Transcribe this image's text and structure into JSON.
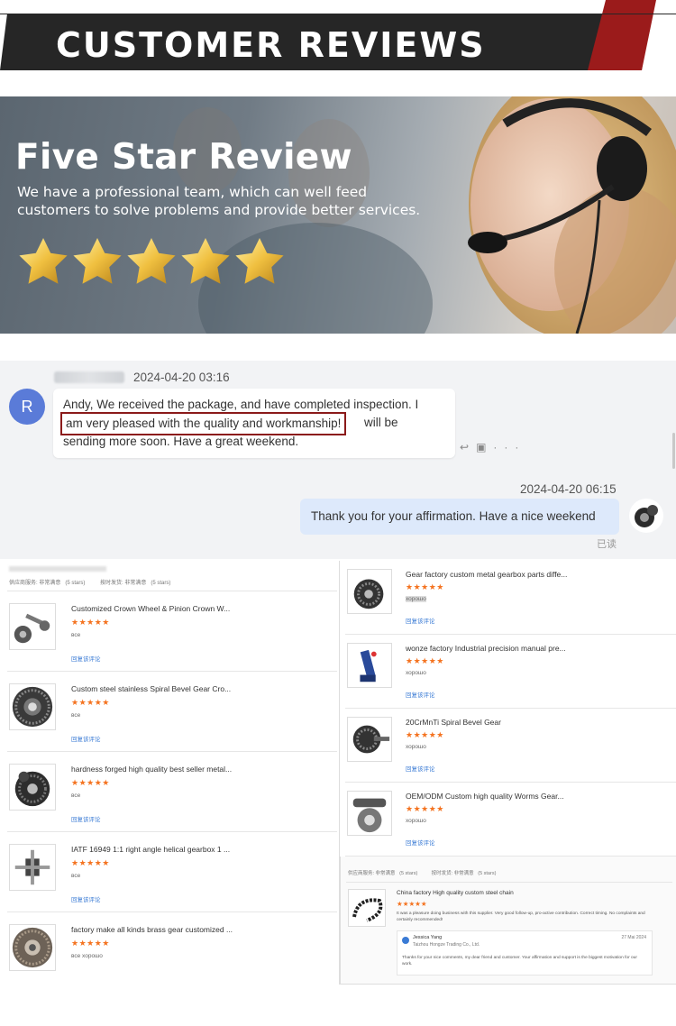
{
  "banner": {
    "title": "CUSTOMER REVIEWS",
    "colors": {
      "bar": "#262626",
      "accent": "#9b1b1b"
    }
  },
  "hero": {
    "title": "Five Star Review",
    "subtitle": "We have a professional team, which can well feed customers to solve problems and provide better services.",
    "stars": 5
  },
  "chat": {
    "incoming": {
      "avatar_letter": "R",
      "timestamp": "2024-04-20 03:16",
      "text_before": "Andy, We received the package, and have completed inspection. I",
      "highlight": "am very pleased with the quality and workmanship!",
      "text_after": "will be",
      "text_last": "sending more soon. Have a great weekend."
    },
    "outgoing": {
      "timestamp": "2024-04-20 06:15",
      "text": "Thank you for your affirmation. Have a nice weekend",
      "status": "已读"
    }
  },
  "reviews_left": {
    "header": "供应商服务: 非常满意   (5 stars)          按时发货: 非常满意   (5 stars)",
    "link_label": "回复该评论",
    "items": [
      {
        "title": "Customized Crown Wheel & Pinion Crown W...",
        "text": "все"
      },
      {
        "title": "Custom steel stainless Spiral Bevel Gear Cro...",
        "text": "все"
      },
      {
        "title": "hardness forged high quality best seller metal...",
        "text": "все"
      },
      {
        "title": "IATF 16949 1:1 right angle helical gearbox 1 ...",
        "text": "все"
      },
      {
        "title": "factory make all kinds brass gear customized ...",
        "text": "все хорошо"
      }
    ]
  },
  "reviews_right": {
    "link_label": "回复该评论",
    "items": [
      {
        "title": "Gear factory custom metal gearbox parts diffe...",
        "text": "хорошо"
      },
      {
        "title": "wonze factory Industrial precision manual pre...",
        "text": "хорошо"
      },
      {
        "title": "20CrMnTi Spiral Bevel Gear",
        "text": "хорошо"
      },
      {
        "title": "OEM/ODM Custom high quality Worms Gear...",
        "text": "хорошо"
      }
    ],
    "second_header": "供应商服务: 非常满意   (5 stars)          按时发货: 非常满意   (5 stars)",
    "chain": {
      "title": "China factory High quality custom steel chain",
      "text": "It was a pleasure doing business with this supplier. Very good follow-up, pro-active contribution. Correct timing. No complaints and certainly recommended!",
      "reply_name": "Jessica Yang",
      "reply_company": "Taizhou Hongze Trading Co., Ltd.",
      "reply_date": "27 Mai 2024",
      "reply_text": "Thanks for your nice comments, my dear friend and customer. Your affirmation and support is the biggest motivation for our work."
    }
  }
}
